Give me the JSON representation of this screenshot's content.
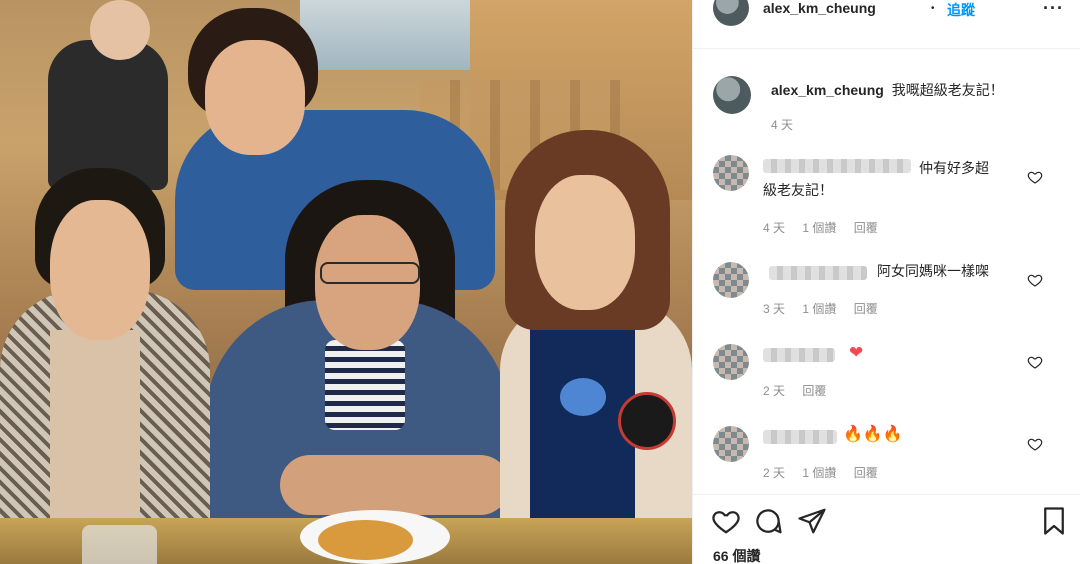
{
  "post": {
    "username": "alex_km_cheung",
    "dot": "•",
    "follow_label": "追蹤",
    "more_label": "···",
    "caption": "我嘅超級老友記！",
    "caption_time": "4 天",
    "likes": "66 個讚"
  },
  "comments": [
    {
      "text_line1": "仲有好多超",
      "text_line2": "級老友記！",
      "time": "4 天",
      "likes": "1 個讚",
      "reply": "回覆"
    },
    {
      "text_line1": "阿女同媽咪一樣㗎",
      "time": "3 天",
      "likes": "1 個讚",
      "reply": "回覆"
    },
    {
      "emoji": "❤",
      "time": "2 天",
      "reply": "回覆"
    },
    {
      "emoji": "🔥🔥🔥",
      "time": "2 天",
      "likes": "1 個讚",
      "reply": "回覆"
    }
  ],
  "colors": {
    "link": "#0095f6",
    "muted": "#8e8e8e",
    "text": "#262626",
    "heart": "#ed4956"
  },
  "icons": [
    "more-icon",
    "heart-icon",
    "comment-icon",
    "share-icon",
    "bookmark-icon"
  ]
}
